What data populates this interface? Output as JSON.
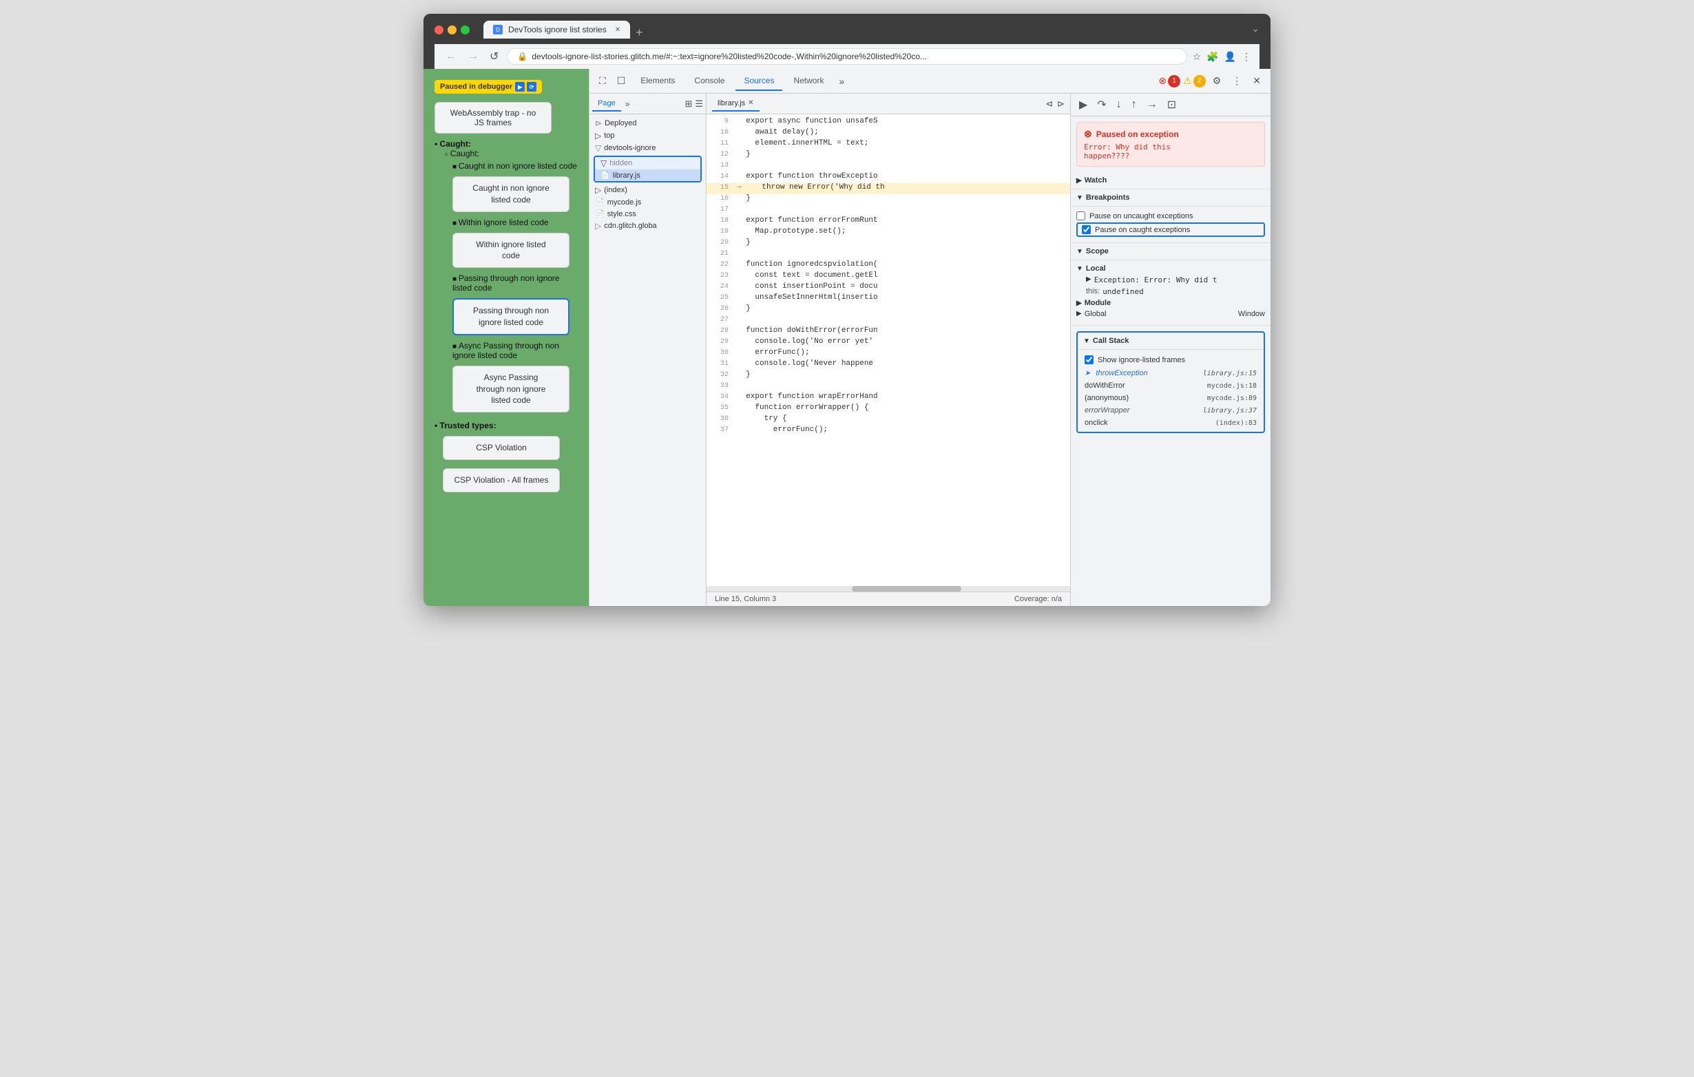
{
  "browser": {
    "tab_title": "DevTools ignore list stories",
    "url": "devtools-ignore-list-stories.glitch.me/#:~:text=ignore%20listed%20code-,Within%20ignore%20listed%20co...",
    "new_tab_label": "+",
    "overflow_label": "⌄"
  },
  "nav": {
    "back_label": "←",
    "forward_label": "→",
    "refresh_label": "↺",
    "lock_icon": "🔒"
  },
  "page": {
    "paused_label": "Paused in debugger",
    "webassembly_btn": "WebAssembly trap - no JS frames",
    "caught_label": "Caught:",
    "items": [
      {
        "label": "Caught in non ignore listed code",
        "btn": "Caught in non ignore\nlisted code",
        "selected": false
      },
      {
        "label": "Within ignore listed code",
        "btn": "Within ignore listed\ncode",
        "selected": false
      },
      {
        "label": "Passing through non ignore listed code",
        "btn": "Passing through non\nignore listed code",
        "selected": true
      },
      {
        "label": "Async Passing through non ignore listed code",
        "btn": "Async Passing\nthrough non ignore\nlisted code",
        "selected": false
      }
    ],
    "trusted_types_label": "Trusted types:",
    "csp_violation_btn": "CSP Violation",
    "csp_violation_all_btn": "CSP Violation - All frames"
  },
  "devtools": {
    "tabs": [
      "Elements",
      "Console",
      "Sources",
      "Network"
    ],
    "active_tab": "Sources",
    "error_count": "1",
    "warn_count": "2",
    "file_tree": {
      "page_tab": "Page",
      "deployed_label": "Deployed",
      "top_label": "top",
      "devtools_ignore_label": "devtools-ignore",
      "hidden_folder": "hidden",
      "library_file": "library.js",
      "index_file": "(index)",
      "mycode_file": "mycode.js",
      "style_file": "style.css",
      "cdn_label": "cdn.glitch.globa"
    },
    "code": {
      "filename": "library.js",
      "lines": [
        {
          "num": 9,
          "text": "  export async function unsafeS",
          "type": "normal"
        },
        {
          "num": 10,
          "text": "    await delay();",
          "type": "normal"
        },
        {
          "num": 11,
          "text": "    element.innerHTML = text;",
          "type": "normal"
        },
        {
          "num": 12,
          "text": "  }",
          "type": "normal"
        },
        {
          "num": 13,
          "text": "",
          "type": "normal"
        },
        {
          "num": 14,
          "text": "  export function throwExceptio",
          "type": "normal"
        },
        {
          "num": 15,
          "text": "    throw new Error('Why did th",
          "type": "highlighted"
        },
        {
          "num": 16,
          "text": "  }",
          "type": "normal"
        },
        {
          "num": 17,
          "text": "",
          "type": "normal"
        },
        {
          "num": 18,
          "text": "  export function errorFromRunt",
          "type": "normal"
        },
        {
          "num": 19,
          "text": "    Map.prototype.set();",
          "type": "normal"
        },
        {
          "num": 20,
          "text": "  }",
          "type": "normal"
        },
        {
          "num": 21,
          "text": "",
          "type": "normal"
        },
        {
          "num": 22,
          "text": "  function ignoredcspviolation(",
          "type": "normal"
        },
        {
          "num": 23,
          "text": "    const text = document.getEl",
          "type": "normal"
        },
        {
          "num": 24,
          "text": "    const insertionPoint = docu",
          "type": "normal"
        },
        {
          "num": 25,
          "text": "    unsafeSetInnerHtml(insertio",
          "type": "normal"
        },
        {
          "num": 26,
          "text": "  }",
          "type": "normal"
        },
        {
          "num": 27,
          "text": "",
          "type": "normal"
        },
        {
          "num": 28,
          "text": "  function doWithError(errorFun",
          "type": "normal"
        },
        {
          "num": 29,
          "text": "    console.log('No error yet'",
          "type": "normal"
        },
        {
          "num": 30,
          "text": "    errorFunc();",
          "type": "normal"
        },
        {
          "num": 31,
          "text": "    console.log('Never happene",
          "type": "normal"
        },
        {
          "num": 32,
          "text": "  }",
          "type": "normal"
        },
        {
          "num": 33,
          "text": "",
          "type": "normal"
        },
        {
          "num": 34,
          "text": "  export function wrapErrorHand",
          "type": "normal"
        },
        {
          "num": 35,
          "text": "    function errorWrapper() {",
          "type": "normal"
        },
        {
          "num": 36,
          "text": "      try {",
          "type": "normal"
        },
        {
          "num": 37,
          "text": "        errorFunc();",
          "type": "normal"
        }
      ],
      "footer_left": "Line 15, Column 3",
      "footer_right": "Coverage: n/a"
    },
    "right_panel": {
      "exception_title": "Paused on exception",
      "exception_msg": "Error: Why did this\nhappen????",
      "watch_label": "Watch",
      "breakpoints_label": "Breakpoints",
      "pause_uncaught_label": "Pause on uncaught exceptions",
      "pause_caught_label": "Pause on caught exceptions",
      "scope_label": "Scope",
      "local_label": "Local",
      "exception_scope": "Exception: Error: Why did t",
      "this_scope": "this: undefined",
      "module_label": "Module",
      "global_label": "Global",
      "global_val": "Window",
      "call_stack_label": "Call Stack",
      "show_ignore_label": "Show ignore-listed frames",
      "call_stack_frames": [
        {
          "fn": "throwException",
          "loc": "library.js:15",
          "current": true,
          "italic": true
        },
        {
          "fn": "doWithError",
          "loc": "mycode.js:18",
          "current": false,
          "italic": false
        },
        {
          "fn": "(anonymous)",
          "loc": "mycode.js:89",
          "current": false,
          "italic": false
        },
        {
          "fn": "errorWrapper",
          "loc": "library.js:37",
          "current": false,
          "italic": true
        },
        {
          "fn": "onclick",
          "loc": "(index):83",
          "current": false,
          "italic": false
        }
      ]
    }
  }
}
